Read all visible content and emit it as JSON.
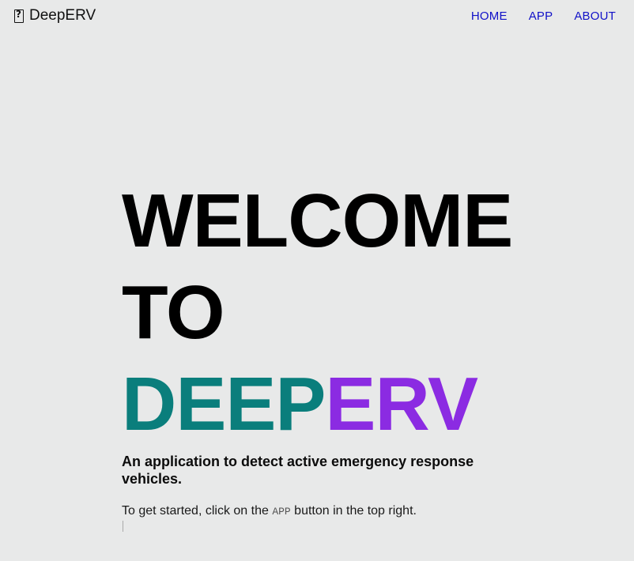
{
  "nav": {
    "brand": "DeepERV",
    "links": [
      "HOME",
      "APP",
      "ABOUT"
    ]
  },
  "hero": {
    "line1": "WELCOME",
    "line2": "TO",
    "line3_part1": "DEEP",
    "line3_part2": "ERV"
  },
  "subtitle": "An application to detect active emergency response vehicles.",
  "instructions": {
    "prefix": "To get started, click on the ",
    "code": "APP",
    "suffix": " button in the top right."
  },
  "colors": {
    "background": "#e8e9e9",
    "nav_link": "#1111c8",
    "teal": "#0a7e7c",
    "purple": "#8b2be2"
  }
}
